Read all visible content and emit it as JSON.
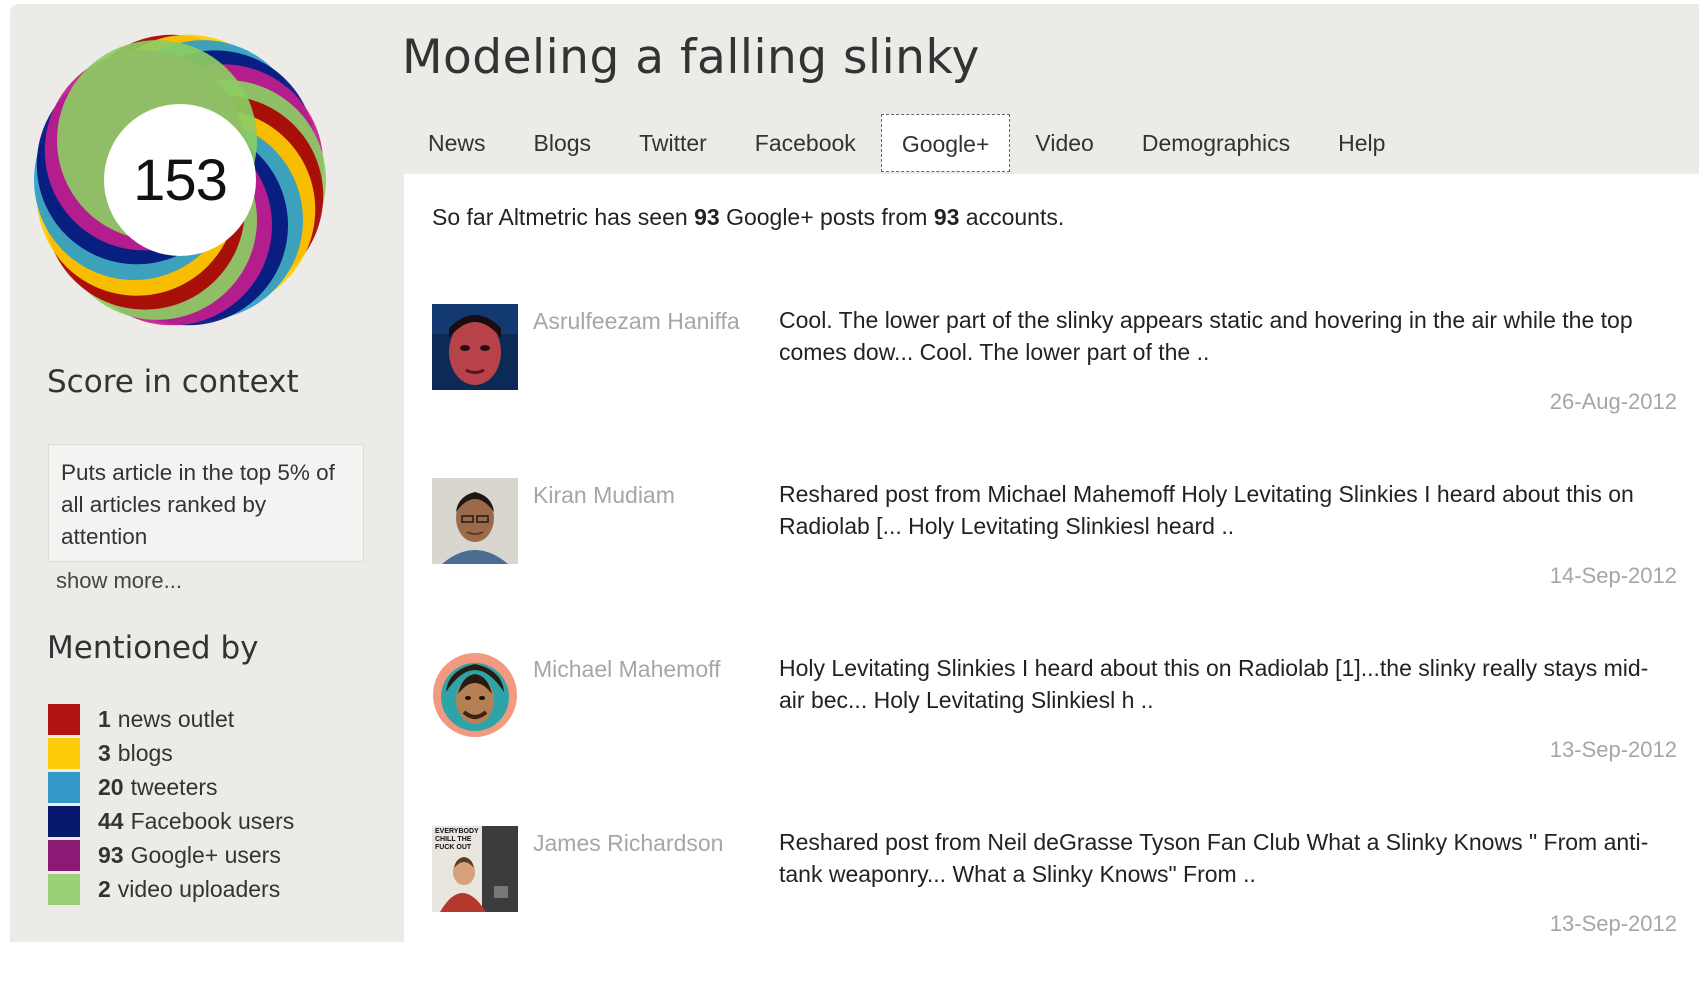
{
  "score": "153",
  "donut_colors": [
    "#aa0000",
    "#ffcc00",
    "#2e9ecc",
    "#03127c",
    "#c21d8f",
    "#8ccc63"
  ],
  "sidebar": {
    "context_heading": "Score in context",
    "context_text": "Puts article in the top 5% of all articles ranked by attention",
    "show_more": "show more...",
    "mentioned_heading": "Mentioned by",
    "mentions": [
      {
        "count": "1",
        "label": "news outlet",
        "color": "#b01414"
      },
      {
        "count": "3",
        "label": "blogs",
        "color": "#ffcc0a"
      },
      {
        "count": "20",
        "label": "tweeters",
        "color": "#3399c8"
      },
      {
        "count": "44",
        "label": "Facebook users",
        "color": "#07186e"
      },
      {
        "count": "93",
        "label": "Google+ users",
        "color": "#8a1a73"
      },
      {
        "count": "2",
        "label": "video uploaders",
        "color": "#9ad178"
      }
    ]
  },
  "title": "Modeling a falling slinky",
  "tabs": [
    "News",
    "Blogs",
    "Twitter",
    "Facebook",
    "Google+",
    "Video",
    "Demographics",
    "Help"
  ],
  "active_tab": "Google+",
  "summary": {
    "prefix": "So far Altmetric has seen",
    "posts": "93",
    "mid": "Google+ posts from",
    "accounts": "93",
    "suffix": "accounts."
  },
  "posts": [
    {
      "author": "Asrulfeezam Haniffa",
      "text": "Cool. The lower part of the slinky appears static and hovering in the air while the top comes dow... Cool. The lower part of the ..",
      "date": "26-Aug-2012"
    },
    {
      "author": "Kiran Mudiam",
      "text": "Reshared post from Michael Mahemoff Holy Levitating Slinkies I heard about this on Radiolab [... Holy Levitating Slinkiesl heard ..",
      "date": "14-Sep-2012"
    },
    {
      "author": "Michael Mahemoff",
      "text": "Holy Levitating Slinkies I heard about this on Radiolab [1]...the slinky really stays mid-air bec... Holy Levitating Slinkiesl h ..",
      "date": "13-Sep-2012"
    },
    {
      "author": "James Richardson",
      "text": "Reshared post from Neil deGrasse Tyson Fan Club What a Slinky Knows \" From anti-tank weaponry... What a Slinky Knows\" From ..",
      "date": "13-Sep-2012"
    }
  ],
  "avatar_poster_text": "EVERYBODY CHILL THE FUCK OUT"
}
